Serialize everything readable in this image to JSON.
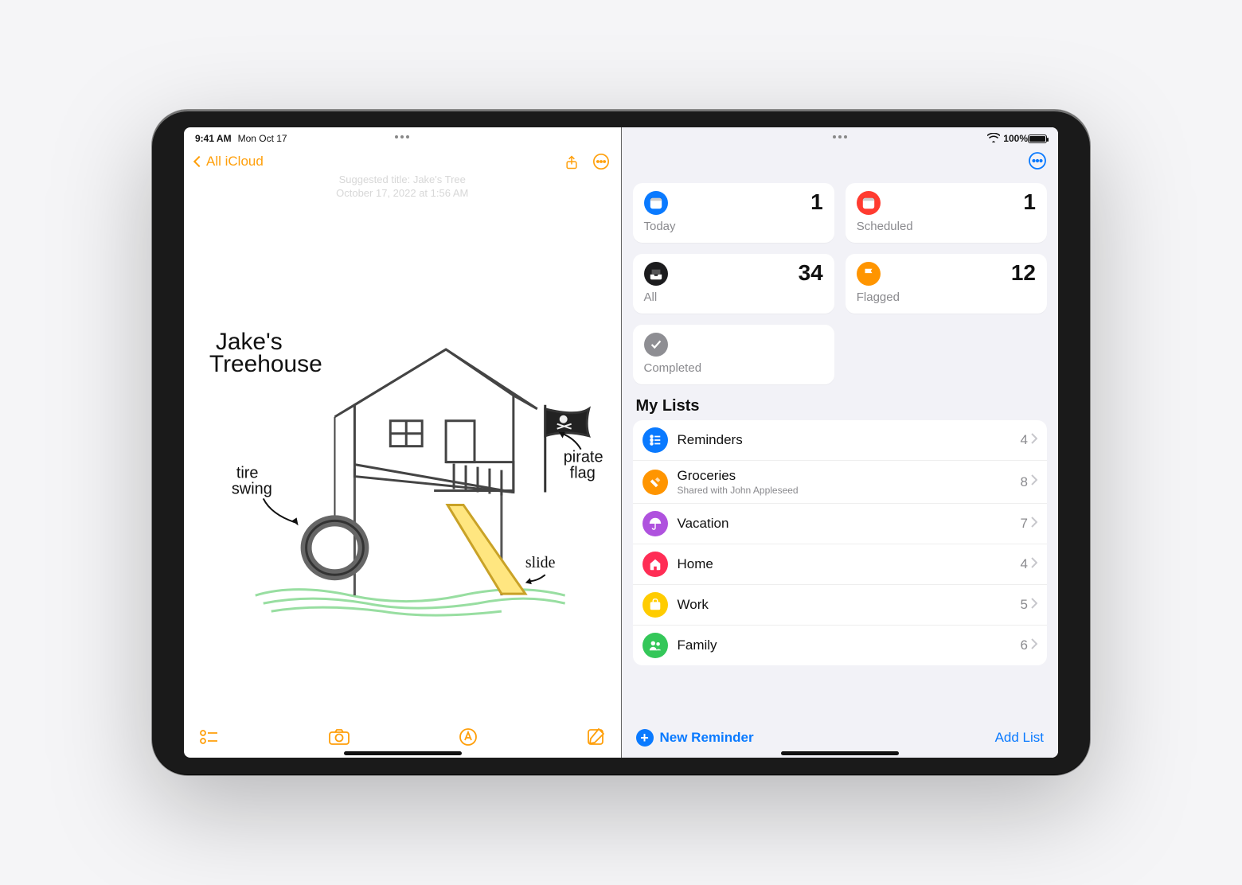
{
  "status": {
    "time": "9:41 AM",
    "date": "Mon Oct 17",
    "wifi": "wifi",
    "battery_pct": "100%"
  },
  "notes": {
    "back_label": "All iCloud",
    "meta_line1": "Suggested title: Jake's Tree",
    "meta_line2": "October 17, 2022 at 1:56 AM",
    "sketch_title": "Jake's\nTreehouse",
    "labels": {
      "tire": "tire\nswing",
      "slide": "slide",
      "flag": "pirate\nflag"
    }
  },
  "reminders": {
    "smart": [
      {
        "key": "today",
        "label": "Today",
        "count": "1",
        "color": "#0a7aff",
        "icon": "calendar"
      },
      {
        "key": "scheduled",
        "label": "Scheduled",
        "count": "1",
        "color": "#ff3b30",
        "icon": "calendar"
      },
      {
        "key": "all",
        "label": "All",
        "count": "34",
        "color": "#1c1c1e",
        "icon": "tray"
      },
      {
        "key": "flagged",
        "label": "Flagged",
        "count": "12",
        "color": "#ff9500",
        "icon": "flag"
      },
      {
        "key": "completed",
        "label": "Completed",
        "count": "",
        "color": "#8e8e93",
        "icon": "check"
      }
    ],
    "mylists_title": "My Lists",
    "lists": [
      {
        "name": "Reminders",
        "sub": "",
        "count": "4",
        "color": "#0a7aff",
        "icon": "list"
      },
      {
        "name": "Groceries",
        "sub": "Shared with John Appleseed",
        "count": "8",
        "color": "#ff9500",
        "icon": "carrot"
      },
      {
        "name": "Vacation",
        "sub": "",
        "count": "7",
        "color": "#af52de",
        "icon": "umbrella"
      },
      {
        "name": "Home",
        "sub": "",
        "count": "4",
        "color": "#ff2d55",
        "icon": "house"
      },
      {
        "name": "Work",
        "sub": "",
        "count": "5",
        "color": "#ffcc00",
        "icon": "briefcase"
      },
      {
        "name": "Family",
        "sub": "",
        "count": "6",
        "color": "#34c759",
        "icon": "people"
      }
    ],
    "new_reminder": "New Reminder",
    "add_list": "Add List"
  }
}
